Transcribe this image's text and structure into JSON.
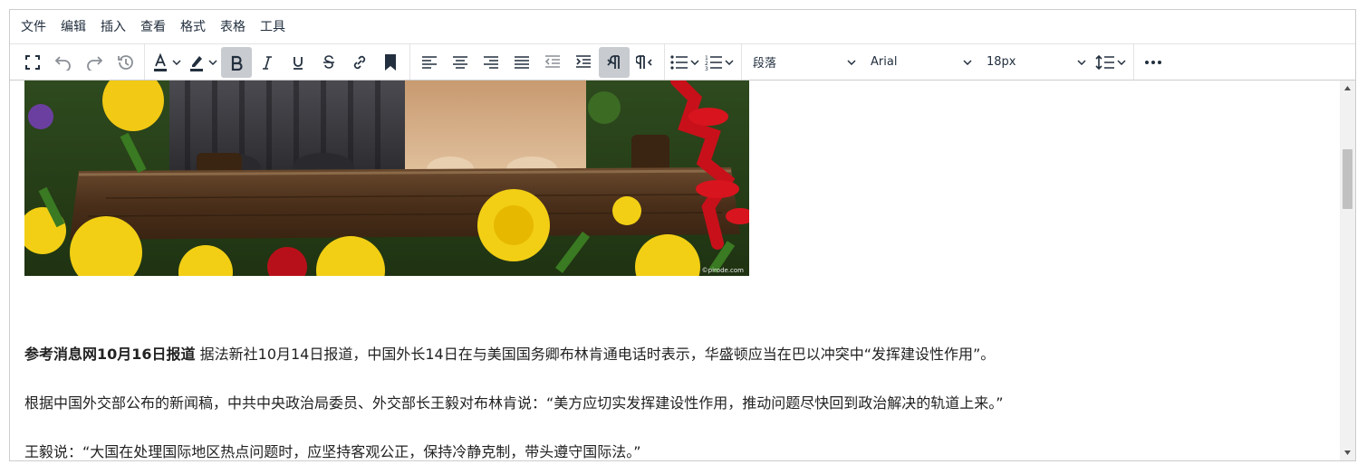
{
  "menubar": {
    "items": [
      "文件",
      "编辑",
      "插入",
      "查看",
      "格式",
      "表格",
      "工具"
    ]
  },
  "toolbar": {
    "block_format": "段落",
    "font_family": "Arial",
    "font_size": "18px",
    "active_buttons": [
      "bold",
      "ltr"
    ]
  },
  "content": {
    "photo_watermark": "©pirode.com",
    "p1_bold": "参考消息网10月16日报道",
    "p1_text": " 据法新社10月14日报道，中国外长14日在与美国国务卿布林肯通电话时表示，华盛顿应当在巴以冲突中“发挥建设性作用”。",
    "p2_text": "根据中国外交部公布的新闻稿，中共中央政治局委员、外交部长王毅对布林肯说：“美方应切实发挥建设性作用，推动问题尽快回到政治解决的轨道上来。”",
    "p3_text": "王毅说：“大国在处理国际地区热点问题时，应坚持客观公正，保持冷静克制，带头遵守国际法。”"
  },
  "colors": {
    "toolbar_text": "#222f3e",
    "active_bg": "#c8cbcf",
    "border": "#cccccc"
  }
}
